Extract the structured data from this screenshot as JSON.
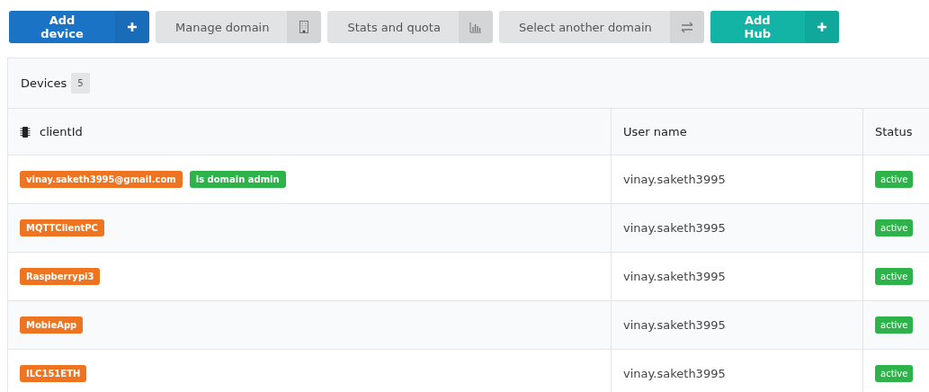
{
  "toolbar": [
    {
      "label": "Add device",
      "kind": "primary"
    },
    {
      "label": "Manage domain",
      "kind": "default"
    },
    {
      "label": "Stats and quota",
      "kind": "default"
    },
    {
      "label": "Select another domain",
      "kind": "default"
    },
    {
      "label": "Add Hub",
      "kind": "teal"
    }
  ],
  "panel": {
    "title": "Devices",
    "count": "5"
  },
  "table": {
    "columns": [
      "clientId",
      "User name",
      "Status"
    ],
    "rows": [
      {
        "client_id": "vinay.saketh3995@gmail.com",
        "badge": "is domain admin",
        "user_name": "vinay.saketh3995",
        "status": "active"
      },
      {
        "client_id": "MQTTClientPC",
        "user_name": "vinay.saketh3995",
        "status": "active"
      },
      {
        "client_id": "Raspberrypi3",
        "user_name": "vinay.saketh3995",
        "status": "active"
      },
      {
        "client_id": "MobieApp",
        "user_name": "vinay.saketh3995",
        "status": "active"
      },
      {
        "client_id": "ILC151ETH",
        "user_name": "vinay.saketh3995",
        "status": "active"
      }
    ]
  }
}
